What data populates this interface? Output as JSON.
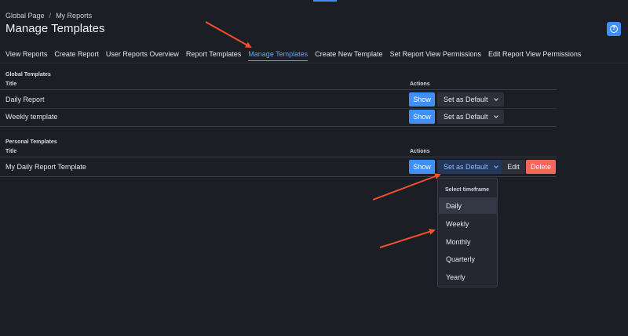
{
  "breadcrumb": {
    "root": "Global Page",
    "separator": "/",
    "current": "My Reports"
  },
  "page": {
    "title": "Manage Templates",
    "help_icon": "?"
  },
  "tabs": [
    {
      "label": "View Reports",
      "active": false
    },
    {
      "label": "Create Report",
      "active": false
    },
    {
      "label": "User Reports Overview",
      "active": false
    },
    {
      "label": "Report Templates",
      "active": false
    },
    {
      "label": "Manage Templates",
      "active": true
    },
    {
      "label": "Create New Template",
      "active": false
    },
    {
      "label": "Set Report View Permissions",
      "active": false
    },
    {
      "label": "Edit Report View Permissions",
      "active": false
    }
  ],
  "global_templates": {
    "section_title": "Global Templates",
    "col_title": "Title",
    "col_actions": "Actions",
    "rows": [
      {
        "title": "Daily Report",
        "show": "Show",
        "default": "Set as Default"
      },
      {
        "title": "Weekly template",
        "show": "Show",
        "default": "Set as Default"
      }
    ]
  },
  "personal_templates": {
    "section_title": "Personal Templates",
    "col_title": "Title",
    "col_actions": "Actions",
    "rows": [
      {
        "title": "My Daily Report Template",
        "show": "Show",
        "default": "Set as Default",
        "edit": "Edit",
        "delete": "Delete"
      }
    ]
  },
  "timeframe_menu": {
    "header": "Select timeframe",
    "options": [
      "Daily",
      "Weekly",
      "Monthly",
      "Quarterly",
      "Yearly"
    ],
    "hovered": "Daily"
  },
  "colors": {
    "background": "#1c1e26",
    "accent": "#3e8ff7",
    "danger": "#f3675b",
    "annotation_arrow": "#f0502a"
  }
}
